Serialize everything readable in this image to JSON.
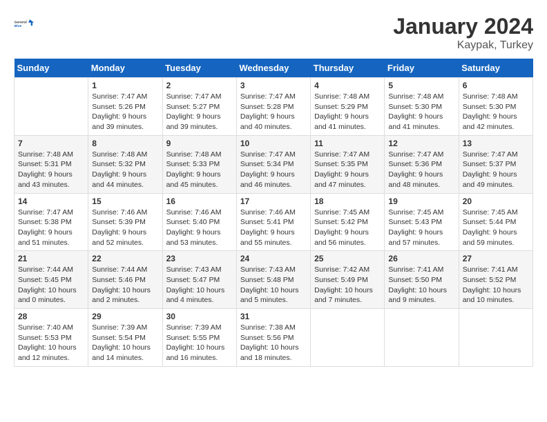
{
  "header": {
    "logo_line1": "General",
    "logo_line2": "Blue",
    "month_year": "January 2024",
    "location": "Kaypak, Turkey"
  },
  "weekdays": [
    "Sunday",
    "Monday",
    "Tuesday",
    "Wednesday",
    "Thursday",
    "Friday",
    "Saturday"
  ],
  "weeks": [
    [
      {
        "day": "",
        "info": ""
      },
      {
        "day": "1",
        "info": "Sunrise: 7:47 AM\nSunset: 5:26 PM\nDaylight: 9 hours\nand 39 minutes."
      },
      {
        "day": "2",
        "info": "Sunrise: 7:47 AM\nSunset: 5:27 PM\nDaylight: 9 hours\nand 39 minutes."
      },
      {
        "day": "3",
        "info": "Sunrise: 7:47 AM\nSunset: 5:28 PM\nDaylight: 9 hours\nand 40 minutes."
      },
      {
        "day": "4",
        "info": "Sunrise: 7:48 AM\nSunset: 5:29 PM\nDaylight: 9 hours\nand 41 minutes."
      },
      {
        "day": "5",
        "info": "Sunrise: 7:48 AM\nSunset: 5:30 PM\nDaylight: 9 hours\nand 41 minutes."
      },
      {
        "day": "6",
        "info": "Sunrise: 7:48 AM\nSunset: 5:30 PM\nDaylight: 9 hours\nand 42 minutes."
      }
    ],
    [
      {
        "day": "7",
        "info": "Sunrise: 7:48 AM\nSunset: 5:31 PM\nDaylight: 9 hours\nand 43 minutes."
      },
      {
        "day": "8",
        "info": "Sunrise: 7:48 AM\nSunset: 5:32 PM\nDaylight: 9 hours\nand 44 minutes."
      },
      {
        "day": "9",
        "info": "Sunrise: 7:48 AM\nSunset: 5:33 PM\nDaylight: 9 hours\nand 45 minutes."
      },
      {
        "day": "10",
        "info": "Sunrise: 7:47 AM\nSunset: 5:34 PM\nDaylight: 9 hours\nand 46 minutes."
      },
      {
        "day": "11",
        "info": "Sunrise: 7:47 AM\nSunset: 5:35 PM\nDaylight: 9 hours\nand 47 minutes."
      },
      {
        "day": "12",
        "info": "Sunrise: 7:47 AM\nSunset: 5:36 PM\nDaylight: 9 hours\nand 48 minutes."
      },
      {
        "day": "13",
        "info": "Sunrise: 7:47 AM\nSunset: 5:37 PM\nDaylight: 9 hours\nand 49 minutes."
      }
    ],
    [
      {
        "day": "14",
        "info": "Sunrise: 7:47 AM\nSunset: 5:38 PM\nDaylight: 9 hours\nand 51 minutes."
      },
      {
        "day": "15",
        "info": "Sunrise: 7:46 AM\nSunset: 5:39 PM\nDaylight: 9 hours\nand 52 minutes."
      },
      {
        "day": "16",
        "info": "Sunrise: 7:46 AM\nSunset: 5:40 PM\nDaylight: 9 hours\nand 53 minutes."
      },
      {
        "day": "17",
        "info": "Sunrise: 7:46 AM\nSunset: 5:41 PM\nDaylight: 9 hours\nand 55 minutes."
      },
      {
        "day": "18",
        "info": "Sunrise: 7:45 AM\nSunset: 5:42 PM\nDaylight: 9 hours\nand 56 minutes."
      },
      {
        "day": "19",
        "info": "Sunrise: 7:45 AM\nSunset: 5:43 PM\nDaylight: 9 hours\nand 57 minutes."
      },
      {
        "day": "20",
        "info": "Sunrise: 7:45 AM\nSunset: 5:44 PM\nDaylight: 9 hours\nand 59 minutes."
      }
    ],
    [
      {
        "day": "21",
        "info": "Sunrise: 7:44 AM\nSunset: 5:45 PM\nDaylight: 10 hours\nand 0 minutes."
      },
      {
        "day": "22",
        "info": "Sunrise: 7:44 AM\nSunset: 5:46 PM\nDaylight: 10 hours\nand 2 minutes."
      },
      {
        "day": "23",
        "info": "Sunrise: 7:43 AM\nSunset: 5:47 PM\nDaylight: 10 hours\nand 4 minutes."
      },
      {
        "day": "24",
        "info": "Sunrise: 7:43 AM\nSunset: 5:48 PM\nDaylight: 10 hours\nand 5 minutes."
      },
      {
        "day": "25",
        "info": "Sunrise: 7:42 AM\nSunset: 5:49 PM\nDaylight: 10 hours\nand 7 minutes."
      },
      {
        "day": "26",
        "info": "Sunrise: 7:41 AM\nSunset: 5:50 PM\nDaylight: 10 hours\nand 9 minutes."
      },
      {
        "day": "27",
        "info": "Sunrise: 7:41 AM\nSunset: 5:52 PM\nDaylight: 10 hours\nand 10 minutes."
      }
    ],
    [
      {
        "day": "28",
        "info": "Sunrise: 7:40 AM\nSunset: 5:53 PM\nDaylight: 10 hours\nand 12 minutes."
      },
      {
        "day": "29",
        "info": "Sunrise: 7:39 AM\nSunset: 5:54 PM\nDaylight: 10 hours\nand 14 minutes."
      },
      {
        "day": "30",
        "info": "Sunrise: 7:39 AM\nSunset: 5:55 PM\nDaylight: 10 hours\nand 16 minutes."
      },
      {
        "day": "31",
        "info": "Sunrise: 7:38 AM\nSunset: 5:56 PM\nDaylight: 10 hours\nand 18 minutes."
      },
      {
        "day": "",
        "info": ""
      },
      {
        "day": "",
        "info": ""
      },
      {
        "day": "",
        "info": ""
      }
    ]
  ]
}
